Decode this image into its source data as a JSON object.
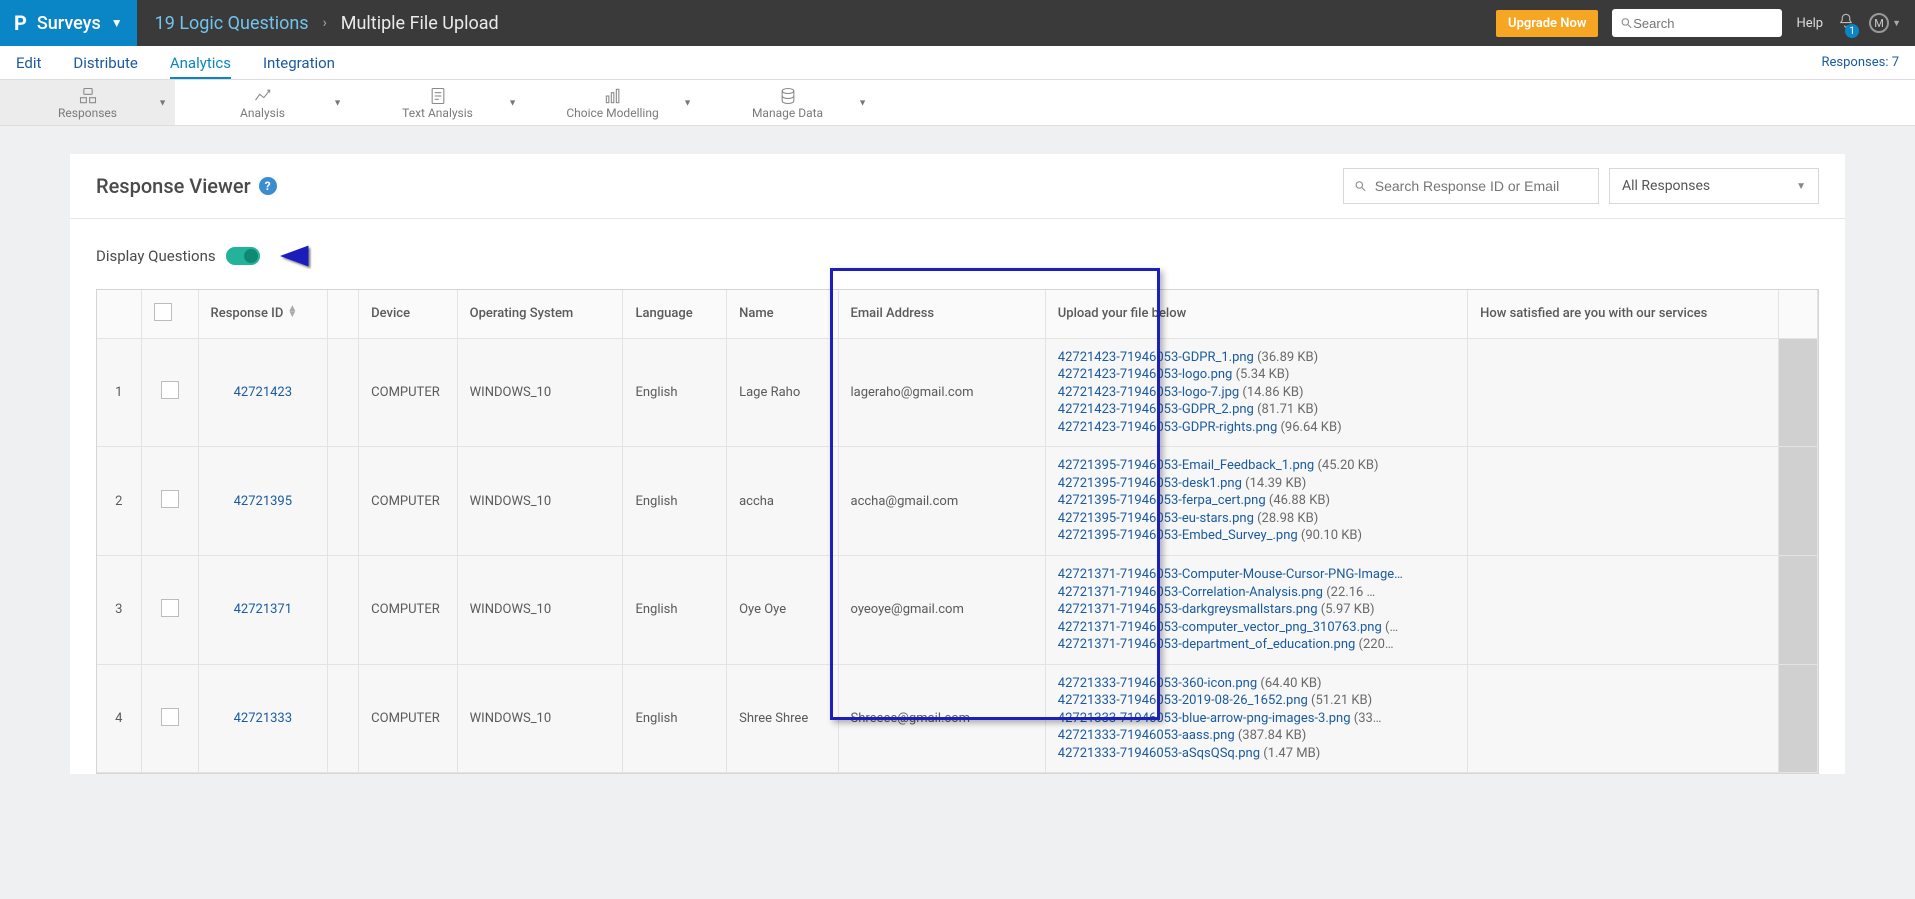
{
  "header": {
    "brand": "Surveys",
    "crumb1": "19 Logic Questions",
    "crumb2": "Multiple File Upload",
    "upgrade": "Upgrade Now",
    "search_ph": "Search",
    "help": "Help",
    "bell_count": "1",
    "avatar": "M"
  },
  "mainnav": {
    "edit": "Edit",
    "distribute": "Distribute",
    "analytics": "Analytics",
    "integration": "Integration",
    "responses": "Responses: 7"
  },
  "subnav": {
    "responses": "Responses",
    "analysis": "Analysis",
    "text": "Text Analysis",
    "choice": "Choice Modelling",
    "manage": "Manage Data"
  },
  "viewer": {
    "title": "Response Viewer",
    "search_ph": "Search Response ID or Email",
    "filter": "All Responses",
    "dq_label": "Display Questions"
  },
  "columns": {
    "rid": "Response ID",
    "device": "Device",
    "os": "Operating System",
    "lang": "Language",
    "name": "Name",
    "email": "Email Address",
    "upload": "Upload your file below",
    "sat": "How satisfied are you with our services"
  },
  "rows": [
    {
      "n": "1",
      "rid": "42721423",
      "device": "COMPUTER",
      "os": "WINDOWS_10",
      "lang": "English",
      "name": "Lage Raho",
      "email": "lageraho@gmail.com",
      "files": [
        {
          "f": "42721423-71946053-GDPR_1.png",
          "s": "(36.89 KB)"
        },
        {
          "f": "42721423-71946053-logo.png",
          "s": "(5.34 KB)"
        },
        {
          "f": "42721423-71946053-logo-7.jpg",
          "s": "(14.86 KB)"
        },
        {
          "f": "42721423-71946053-GDPR_2.png",
          "s": "(81.71 KB)"
        },
        {
          "f": "42721423-71946053-GDPR-rights.png",
          "s": "(96.64 KB)"
        }
      ]
    },
    {
      "n": "2",
      "rid": "42721395",
      "device": "COMPUTER",
      "os": "WINDOWS_10",
      "lang": "English",
      "name": "accha",
      "email": "accha@gmail.com",
      "files": [
        {
          "f": "42721395-71946053-Email_Feedback_1.png",
          "s": "(45.20 KB)"
        },
        {
          "f": "42721395-71946053-desk1.png",
          "s": "(14.39 KB)"
        },
        {
          "f": "42721395-71946053-ferpa_cert.png",
          "s": "(46.88 KB)"
        },
        {
          "f": "42721395-71946053-eu-stars.png",
          "s": "(28.98 KB)"
        },
        {
          "f": "42721395-71946053-Embed_Survey_.png",
          "s": "(90.10 KB)"
        }
      ]
    },
    {
      "n": "3",
      "rid": "42721371",
      "device": "COMPUTER",
      "os": "WINDOWS_10",
      "lang": "English",
      "name": "Oye Oye",
      "email": "oyeoye@gmail.com",
      "files": [
        {
          "f": "42721371-71946053-Computer-Mouse-Cursor-PNG-Image…",
          "s": ""
        },
        {
          "f": "42721371-71946053-Correlation-Analysis.png",
          "s": "(22.16 …"
        },
        {
          "f": "42721371-71946053-darkgreysmallstars.png",
          "s": "(5.97 KB)"
        },
        {
          "f": "42721371-71946053-computer_vector_png_310763.png",
          "s": "(…"
        },
        {
          "f": "42721371-71946053-department_of_education.png",
          "s": "(220…"
        }
      ]
    },
    {
      "n": "4",
      "rid": "42721333",
      "device": "COMPUTER",
      "os": "WINDOWS_10",
      "lang": "English",
      "name": "Shree Shree",
      "email": "Shreeee@gmail.com",
      "files": [
        {
          "f": "42721333-71946053-360-icon.png",
          "s": "(64.40 KB)"
        },
        {
          "f": "42721333-71946053-2019-08-26_1652.png",
          "s": "(51.21 KB)"
        },
        {
          "f": "42721333-71946053-blue-arrow-png-images-3.png",
          "s": "(33…"
        },
        {
          "f": "42721333-71946053-aass.png",
          "s": "(387.84 KB)"
        },
        {
          "f": "42721333-71946053-aSqsQSq.png",
          "s": "(1.47 MB)"
        }
      ]
    }
  ]
}
